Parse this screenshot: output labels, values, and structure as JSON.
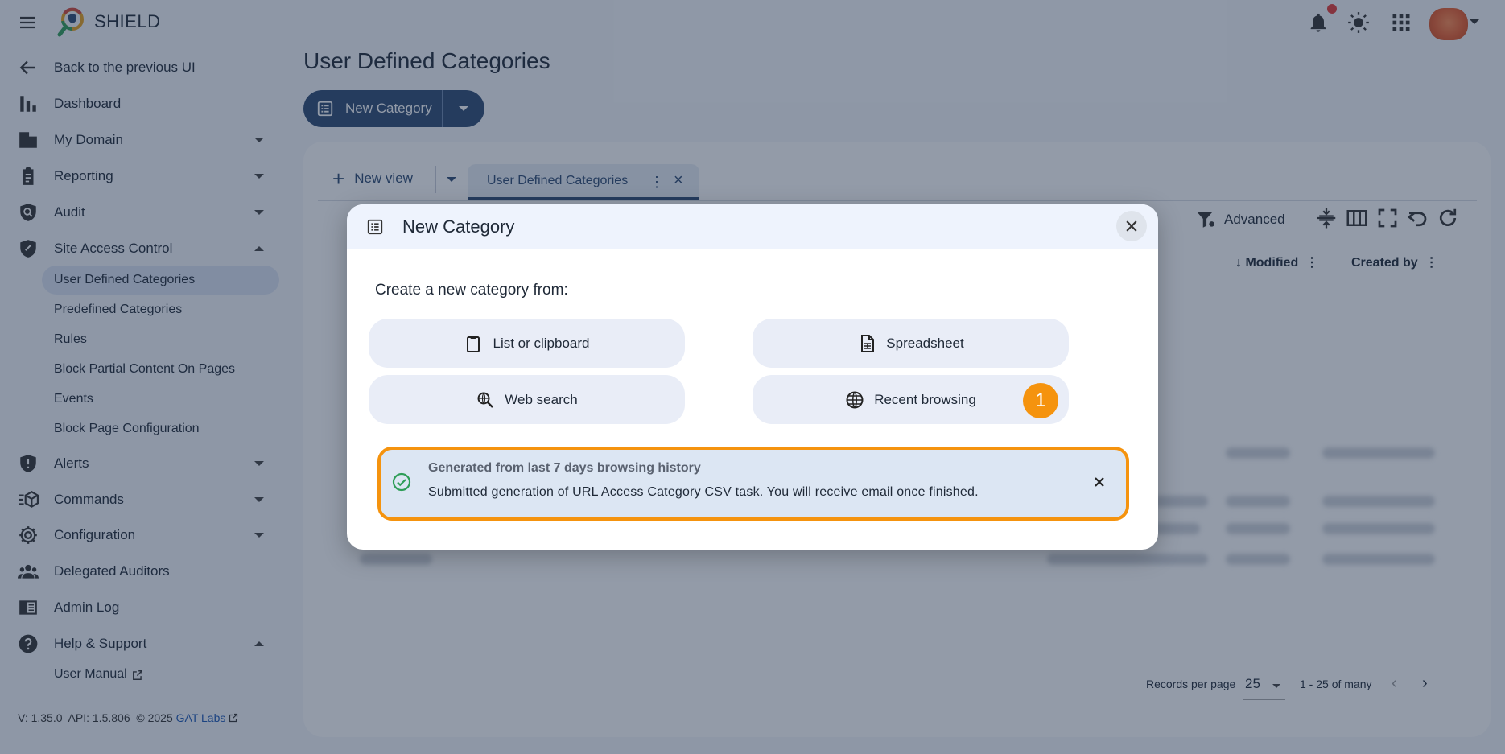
{
  "app": {
    "brand": "SHIELD"
  },
  "sidebar": {
    "back": "Back to the previous UI",
    "items": [
      {
        "label": "Dashboard"
      },
      {
        "label": "My Domain"
      },
      {
        "label": "Reporting"
      },
      {
        "label": "Audit"
      },
      {
        "label": "Site Access Control"
      },
      {
        "label": "Alerts"
      },
      {
        "label": "Commands"
      },
      {
        "label": "Configuration"
      },
      {
        "label": "Delegated Auditors"
      },
      {
        "label": "Admin Log"
      },
      {
        "label": "Help & Support"
      }
    ],
    "site_access_sub": [
      {
        "label": "User Defined Categories"
      },
      {
        "label": "Predefined Categories"
      },
      {
        "label": "Rules"
      },
      {
        "label": "Block Partial Content On Pages"
      },
      {
        "label": "Events"
      },
      {
        "label": "Block Page Configuration"
      }
    ],
    "help_sub": [
      {
        "label": "User Manual"
      }
    ],
    "footer": {
      "version": "V: 1.35.0",
      "api": "API: 1.5.806",
      "copyright": "© 2025",
      "company": "GAT Labs"
    }
  },
  "main": {
    "title": "User Defined Categories",
    "new_category_label": "New Category",
    "new_view_label": "New view",
    "view_tab_label": "User Defined Categories",
    "advanced_label": "Advanced",
    "columns": {
      "modified": "Modified",
      "created_by": "Created by"
    },
    "pager": {
      "records_label": "Records per page",
      "per_page": "25",
      "range": "1 - 25 of many"
    }
  },
  "dialog": {
    "title": "New Category",
    "subtitle": "Create a new category from:",
    "options": {
      "list": "List or clipboard",
      "spreadsheet": "Spreadsheet",
      "web_search": "Web search",
      "recent_browsing": "Recent browsing"
    },
    "step_badge": "1",
    "alert": {
      "title": "Generated from last 7 days browsing history",
      "message": "Submitted generation of URL Access Category CSV task. You will receive email once finished."
    }
  },
  "colors": {
    "accent": "#2c4a72",
    "highlight": "#f5930e",
    "success": "#2e9d57",
    "notification": "#e53935"
  }
}
